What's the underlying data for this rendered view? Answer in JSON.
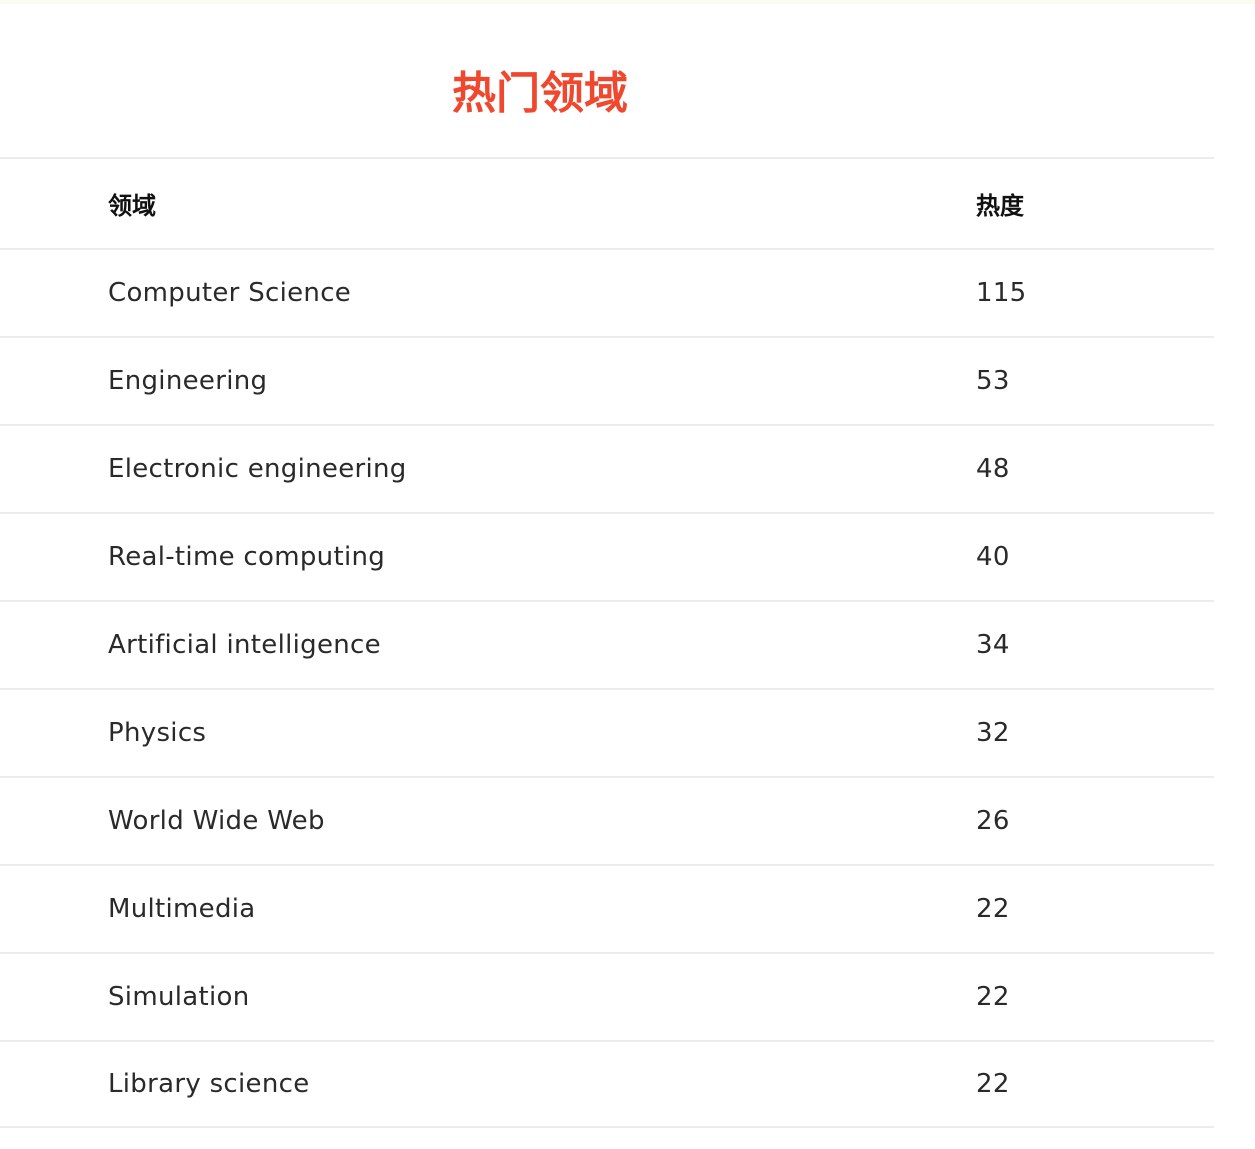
{
  "page": {
    "title": "热门领域",
    "title_color": "#f0482f"
  },
  "table": {
    "headers": {
      "name": "领域",
      "count": "热度"
    },
    "rows": [
      {
        "name": "Computer Science",
        "count": "115"
      },
      {
        "name": "Engineering",
        "count": "53"
      },
      {
        "name": "Electronic engineering",
        "count": "48"
      },
      {
        "name": "Real-time computing",
        "count": "40"
      },
      {
        "name": "Artificial intelligence",
        "count": "34"
      },
      {
        "name": "Physics",
        "count": "32"
      },
      {
        "name": "World Wide Web",
        "count": "26"
      },
      {
        "name": "Multimedia",
        "count": "22"
      },
      {
        "name": "Simulation",
        "count": "22"
      },
      {
        "name": "Library science",
        "count": "22"
      }
    ]
  }
}
